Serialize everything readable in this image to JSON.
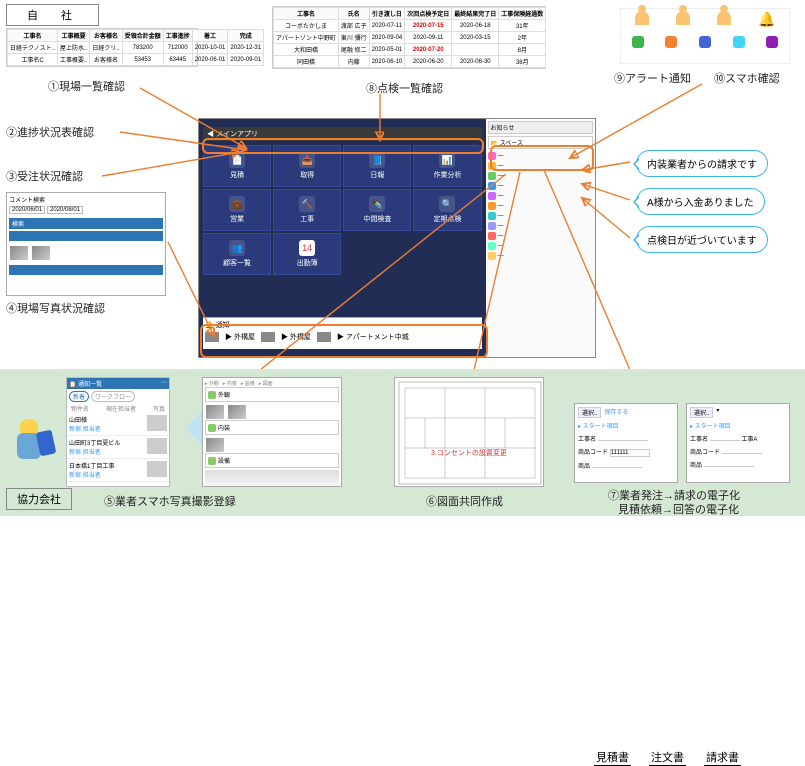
{
  "labels": {
    "jisha": "自　社",
    "kyoryoku": "協力会社"
  },
  "captions": {
    "c1": "①現場一覧確認",
    "c2": "②進捗状況表確認",
    "c3": "③受注状況確認",
    "c4": "④現場写真状況確認",
    "c5": "⑤業者スマホ写真撮影登録",
    "c6": "⑥図面共同作成",
    "c7a": "⑦業者発注→請求の電子化",
    "c7b": "見積依頼→回答の電子化",
    "c8": "⑧点検一覧確認",
    "c9": "⑨アラート通知",
    "c10": "⑩スマホ確認"
  },
  "table1": {
    "headers": [
      "工事名",
      "工事概要",
      "お客様名",
      "受領合計金額",
      "工事進捗",
      "着工",
      "完成"
    ],
    "rows": [
      [
        "日経テクノスト..",
        "屋上防水..",
        "日経クリ..",
        "783200",
        "712000",
        "2020-10-01",
        "2020-12-31"
      ],
      [
        "工事名C",
        "工事概要..",
        "お客様名",
        "53453",
        "63445",
        "2020-06-01",
        "2020-09-01"
      ]
    ]
  },
  "table2": {
    "headers": [
      "工事名",
      "氏名",
      "引き渡し日",
      "次回点検予定日",
      "最終結果完了日",
      "工事保険経過数"
    ],
    "rows": [
      [
        "コーボたかしま",
        "渡部 広子",
        "2020-07-11",
        "2020-07-15",
        "2020-06-18",
        "31年"
      ],
      [
        "アパートゾント中野町",
        "東川 彌行",
        "2020-09-04",
        "2020-09-11",
        "2020-03-15",
        "2年"
      ],
      [
        "大和田橋",
        "尾融 修二",
        "2020-05-01",
        "2020-07-20",
        "",
        "8月"
      ],
      [
        "同田橋",
        "内藤",
        "2020-06-10",
        "2020-06-20",
        "2020-06-30",
        "38月"
      ]
    ]
  },
  "app": {
    "header": "メインアプリ",
    "right_header": "お知らせ",
    "space": "スペース",
    "tiles": [
      "見積",
      "取得",
      "日報",
      "作業分析",
      "営業",
      "工事",
      "中間検査",
      "定期点検",
      "顧客一覧",
      "出勤簿"
    ],
    "notice": "通知"
  },
  "sidebar_items": [
    "—",
    "—",
    "—",
    "—",
    "—",
    "—",
    "—",
    "—",
    "—",
    "—",
    "—"
  ],
  "bubbles": {
    "b1": "内装業者からの請求です",
    "b2": "A様から入金ありました",
    "b3": "点検日が近づいています"
  },
  "docs": {
    "d1": "見積書",
    "d2": "注文書",
    "d3": "請求書"
  },
  "photo_panel": {
    "header_left": "通知一覧",
    "tabs": [
      "新着",
      "ワークフロー"
    ],
    "col_names": "現在担当者",
    "col_photo": "写真",
    "rows": [
      {
        "name": "山田様",
        "sub": "新宿 担当者"
      },
      {
        "name": "山田町3丁目夏ビル",
        "sub": "新宿 担当者"
      },
      {
        "name": "日本橋1丁目工事",
        "sub": "新宿 担当者"
      }
    ]
  },
  "panel4": {
    "title": "コメント検索",
    "date1": "2020/06/01",
    "date2": "2020/08/01",
    "btn": "検索"
  },
  "drawing_note": "3.コンセントの設置変更"
}
